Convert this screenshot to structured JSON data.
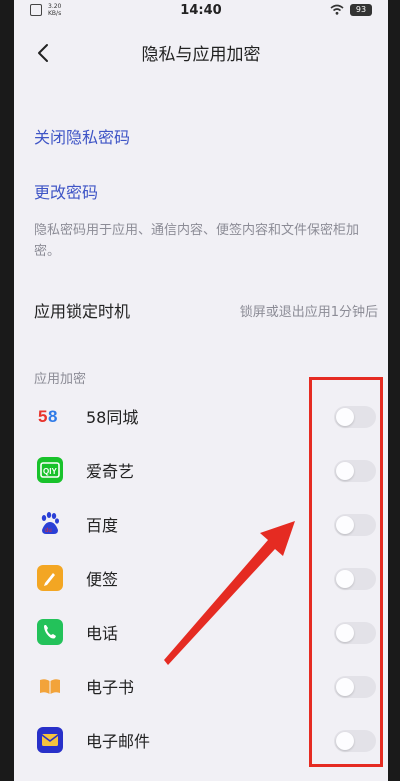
{
  "status_bar": {
    "network": "3.20\nKB/s",
    "time": "14:40",
    "battery": "93"
  },
  "header": {
    "title": "隐私与应用加密"
  },
  "options": {
    "close_privacy_password": "关闭隐私密码",
    "change_password": "更改密码",
    "description": "隐私密码用于应用、通信内容、便签内容和文件保密柜加密。"
  },
  "lock_timing": {
    "label": "应用锁定时机",
    "value": "锁屏或退出应用1分钟后"
  },
  "app_encryption": {
    "section_title": "应用加密",
    "apps": [
      {
        "name": "58同城",
        "icon": "58-tongcheng-icon",
        "enabled": false
      },
      {
        "name": "爱奇艺",
        "icon": "iqiyi-icon",
        "enabled": false
      },
      {
        "name": "百度",
        "icon": "baidu-paw-icon",
        "enabled": false
      },
      {
        "name": "便签",
        "icon": "notes-pencil-icon",
        "enabled": false
      },
      {
        "name": "电话",
        "icon": "phone-icon",
        "enabled": false
      },
      {
        "name": "电子书",
        "icon": "ebook-icon",
        "enabled": false
      },
      {
        "name": "电子邮件",
        "icon": "email-icon",
        "enabled": false
      }
    ]
  },
  "colors": {
    "background": "#f1f0f5",
    "link": "#3f55c6",
    "annotation": "#e52b22"
  }
}
